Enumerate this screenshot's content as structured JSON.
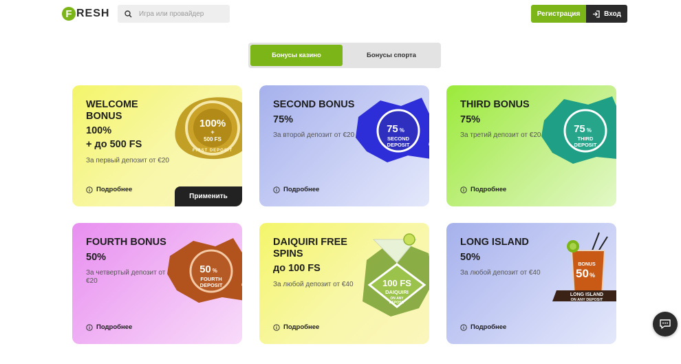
{
  "header": {
    "logo_letter": "F",
    "logo_text": "RESH",
    "search_placeholder": "Игра или провайдер",
    "register_label": "Регистрация",
    "login_label": "Вход"
  },
  "tabs": [
    {
      "label": "Бонусы казино",
      "active": true
    },
    {
      "label": "Бонусы спорта",
      "active": false
    }
  ],
  "cards": [
    {
      "title": "WELCOME BONUS",
      "amount": "100%\n+ до 500 FS",
      "desc": "За первый депозит от €20",
      "more": "Подробнее",
      "apply": "Применить",
      "badge_line1": "100%",
      "badge_line2": "+",
      "badge_line3": "500 FS",
      "badge_arc": "FIRST DEPOSIT"
    },
    {
      "title": "SECOND BONUS",
      "amount": "75%",
      "desc": "За второй депозит от €20",
      "more": "Подробнее",
      "badge_line1": "75",
      "badge_pct": "%",
      "badge_line2": "SECOND",
      "badge_line3": "DEPOSIT"
    },
    {
      "title": "THIRD BONUS",
      "amount": "75%",
      "desc": "За третий депозит от €20",
      "more": "Подробнее",
      "badge_line1": "75",
      "badge_pct": "%",
      "badge_line2": "THIRD",
      "badge_line3": "DEPOSIT"
    },
    {
      "title": "FOURTH BONUS",
      "amount": "50%",
      "desc": "За четвертый депозит от €20",
      "more": "Подробнее",
      "badge_line1": "50",
      "badge_pct": "%",
      "badge_line2": "FOURTH",
      "badge_line3": "DEPOSIT"
    },
    {
      "title": "DAIQUIRI FREE SPINS",
      "amount": "до 100 FS",
      "desc": "За любой депозит от €40",
      "more": "Подробнее",
      "badge_line1": "100 FS",
      "badge_line2": "DAIQUIRI",
      "badge_line3": "ON ANY",
      "badge_line4": "DEPOSIT"
    },
    {
      "title": "LONG ISLAND",
      "amount": "50%",
      "desc": "За любой депозит от €40",
      "more": "Подробнее",
      "badge_line1": "BONUS",
      "badge_line2": "50",
      "badge_pct": "%",
      "badge_line3": "LONG ISLAND",
      "badge_line4": "ON ANY DEPOSIT"
    }
  ],
  "colors": {
    "accent": "#7cb518",
    "dark": "#2b2b2b"
  }
}
